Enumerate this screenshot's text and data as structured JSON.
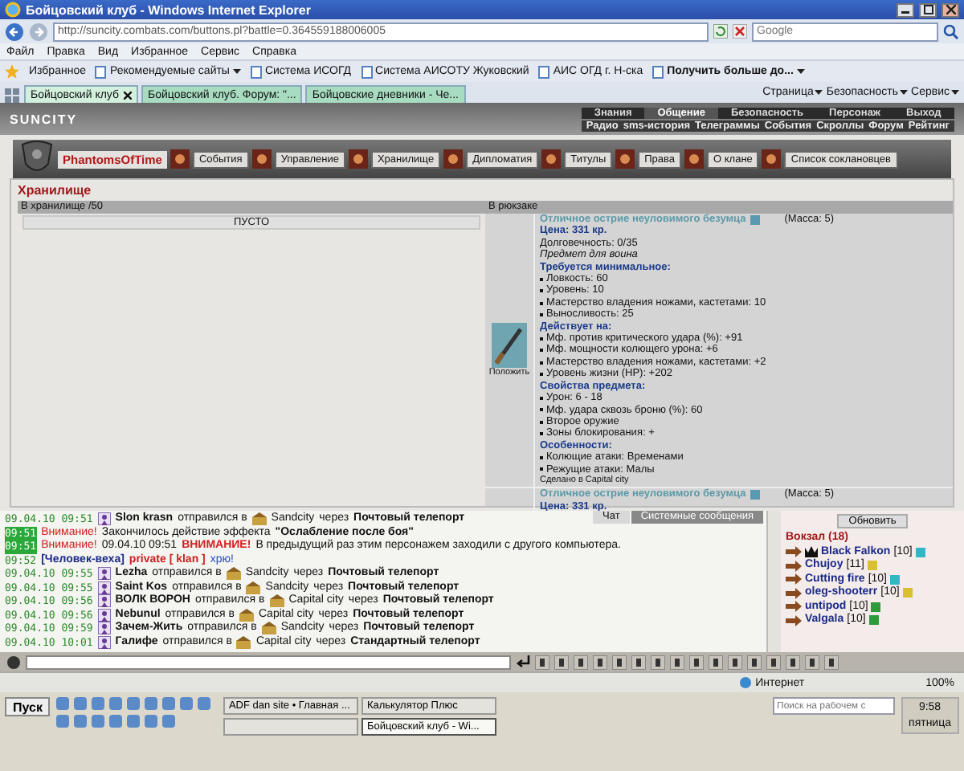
{
  "browser": {
    "title": "Бойцовский клуб - Windows Internet Explorer",
    "url": "http://suncity.combats.com/buttons.pl?battle=0.364559188006005",
    "search_placeholder": "Google",
    "menu": [
      "Файл",
      "Правка",
      "Вид",
      "Избранное",
      "Сервис",
      "Справка"
    ],
    "favorites_label": "Избранное",
    "favorites": [
      {
        "label": "Рекомендуемые сайты",
        "dropdown": true,
        "bold": false
      },
      {
        "label": "Система ИСОГД",
        "dropdown": false,
        "bold": false
      },
      {
        "label": "Система АИСОТУ Жуковский",
        "dropdown": false,
        "bold": false
      },
      {
        "label": "АИС ОГД г. Н-ска",
        "dropdown": false,
        "bold": false
      },
      {
        "label": "Получить больше до...",
        "dropdown": true,
        "bold": true
      }
    ],
    "tabs": [
      {
        "label": "Бойцовский клуб",
        "selected": true
      },
      {
        "label": "Бойцовский клуб. Форум: \"...",
        "selected": false
      },
      {
        "label": "Бойцовские дневники - Че...",
        "selected": false
      }
    ],
    "commands": [
      "Страница",
      "Безопасность",
      "Сервис"
    ]
  },
  "game": {
    "logo": "SUNCITY",
    "top_menu": [
      {
        "label": "Знания",
        "selected": false
      },
      {
        "label": "Общение",
        "selected": true
      },
      {
        "label": "Безопасность",
        "selected": false
      },
      {
        "label": "Персонаж",
        "selected": false
      },
      {
        "label": "Выход",
        "selected": false
      }
    ],
    "sub_menu": [
      "Радио",
      "sms-история",
      "Телеграммы",
      "События",
      "Скроллы",
      "Форум",
      "Рейтинг"
    ],
    "clan_nav": [
      {
        "label": "PhantomsOfTime",
        "kind": "clan"
      },
      {
        "label": "События",
        "kind": "section"
      },
      {
        "label": "Управление",
        "kind": "section"
      },
      {
        "label": "Хранилище",
        "kind": "section"
      },
      {
        "label": "Дипломатия",
        "kind": "section"
      },
      {
        "label": "Титулы",
        "kind": "section"
      },
      {
        "label": "Права",
        "kind": "section"
      },
      {
        "label": "О клане",
        "kind": "section"
      },
      {
        "label": "Список соклановцев",
        "kind": "section"
      }
    ]
  },
  "storage": {
    "title": "Хранилище",
    "left": {
      "header": "В хранилище /50",
      "empty": "ПУСТО"
    },
    "right": {
      "header": "В рюкзаке",
      "action": "Положить",
      "items": [
        {
          "name": "Отличное острие неуловимого безумца",
          "mass": "(Масса: 5)",
          "price": "Цена: 331 кр.",
          "durability": "Долговечность: 0/35",
          "note": "Предмет для воина",
          "sections": [
            {
              "title": "Требуется минимальное:",
              "lines": [
                "Ловкость: 60",
                "Уровень: 10",
                "Мастерство владения ножами, кастетами: 10",
                "Выносливость: 25"
              ]
            },
            {
              "title": "Действует на:",
              "lines": [
                "Мф. против критического удара (%): +91",
                "Мф. мощности колющего урона: +6",
                "Мастерство владения ножами, кастетами: +2",
                "Уровень жизни (HP): +202"
              ]
            },
            {
              "title": "Свойства предмета:",
              "lines": [
                "Урон: 6 - 18",
                "Мф. удара сквозь броню (%): 60",
                "Второе оружие",
                "Зоны блокирования: +"
              ]
            },
            {
              "title": "Особенности:",
              "lines": [
                "Колющие атаки: Временами",
                "Режущие атаки: Малы"
              ]
            }
          ],
          "made": "Сделано в Capital city"
        },
        {
          "name": "Отличное острие неуловимого безумца",
          "mass": "(Масса: 5)",
          "price": "Цена: 331 кр."
        }
      ]
    }
  },
  "chat": {
    "tabs": [
      {
        "label": "Чат",
        "selected": true
      },
      {
        "label": "Системные сообщения",
        "selected": false
      }
    ],
    "lines": [
      {
        "kind": "travel",
        "time": "09.04.10 09:51",
        "highlight": false,
        "name": "Slon krasn",
        "verb": "отправился в",
        "city": "Sandcity",
        "via": "через",
        "teleport": "Почтовый телепорт"
      },
      {
        "kind": "message",
        "time": "09:51",
        "highlight": true,
        "segments": [
          {
            "text": "Внимание!",
            "kind": "alert"
          },
          {
            "text": "Закончилось действие эффекта",
            "kind": "plain"
          },
          {
            "text": "\"Ослабление после боя\"",
            "kind": "bold"
          }
        ]
      },
      {
        "kind": "message",
        "time": "09:51",
        "highlight": true,
        "segments": [
          {
            "text": "Внимание!",
            "kind": "alert"
          },
          {
            "text": "09.04.10 09:51",
            "kind": "plain"
          },
          {
            "text": "ВНИМАНИЕ!",
            "kind": "alertbold"
          },
          {
            "text": "В предыдущий раз этим персонажем заходили с другого компьютера.",
            "kind": "plain"
          }
        ]
      },
      {
        "kind": "message",
        "time": "09:52",
        "highlight": false,
        "segments": [
          {
            "text": "[Человек-веха]",
            "kind": "name"
          },
          {
            "text": "private [ klan ]",
            "kind": "alertbold"
          },
          {
            "text": "хрю!",
            "kind": "private"
          }
        ]
      },
      {
        "kind": "travel",
        "time": "09.04.10 09:55",
        "highlight": false,
        "name": "Lezha",
        "verb": "отправился в",
        "city": "Sandcity",
        "via": "через",
        "teleport": "Почтовый телепорт"
      },
      {
        "kind": "travel",
        "time": "09.04.10 09:55",
        "highlight": false,
        "name": "Saint Kos",
        "verb": "отправился в",
        "city": "Sandcity",
        "via": "через",
        "teleport": "Почтовый телепорт"
      },
      {
        "kind": "travel",
        "time": "09.04.10 09:56",
        "highlight": false,
        "name": "ВОЛК ВОРОН",
        "verb": "отправился в",
        "city": "Capital city",
        "via": "через",
        "teleport": "Почтовый телепорт"
      },
      {
        "kind": "travel",
        "time": "09.04.10 09:56",
        "highlight": false,
        "name": "Nebunul",
        "verb": "отправился в",
        "city": "Capital city",
        "via": "через",
        "teleport": "Почтовый телепорт"
      },
      {
        "kind": "travel",
        "time": "09.04.10 09:59",
        "highlight": false,
        "name": "Зачем-Жить",
        "verb": "отправился в",
        "city": "Sandcity",
        "via": "через",
        "teleport": "Почтовый телепорт"
      },
      {
        "kind": "travel",
        "time": "09.04.10 10:01",
        "highlight": false,
        "name": "Галифе",
        "verb": "отправился в",
        "city": "Capital city",
        "via": "через",
        "teleport": "Стандартный телепорт"
      }
    ],
    "refresh": "Обновить",
    "location": "Вокзал (18)",
    "users": [
      {
        "name": "Black Falkon",
        "level": "[10]",
        "crown": true,
        "color": "#33b5c8"
      },
      {
        "name": "Chujoy",
        "level": "[11]",
        "crown": false,
        "color": "#d8c030"
      },
      {
        "name": "Cutting fire",
        "level": "[10]",
        "crown": false,
        "color": "#33b5c8"
      },
      {
        "name": "oleg-shooterr",
        "level": "[10]",
        "crown": false,
        "color": "#d8c030"
      },
      {
        "name": "untipod",
        "level": "[10]",
        "crown": false,
        "color": "#2e9a3c"
      },
      {
        "name": "Valgala",
        "level": "[10]",
        "crown": false,
        "color": "#2e9a3c"
      }
    ]
  },
  "status": {
    "zone": "Интернет",
    "zoom": "100%"
  },
  "taskbar": {
    "start": "Пуск",
    "tasks": [
      {
        "label": "ADF dan site • Главная ...",
        "selected": false
      },
      {
        "label": "Калькулятор Плюс",
        "selected": false
      },
      {
        "selected": false
      },
      {
        "label": "Бойцовский клуб - Wi...",
        "selected": true
      }
    ],
    "search_placeholder": "Поиск на рабочем с",
    "time": "9:58",
    "day": "пятница"
  }
}
